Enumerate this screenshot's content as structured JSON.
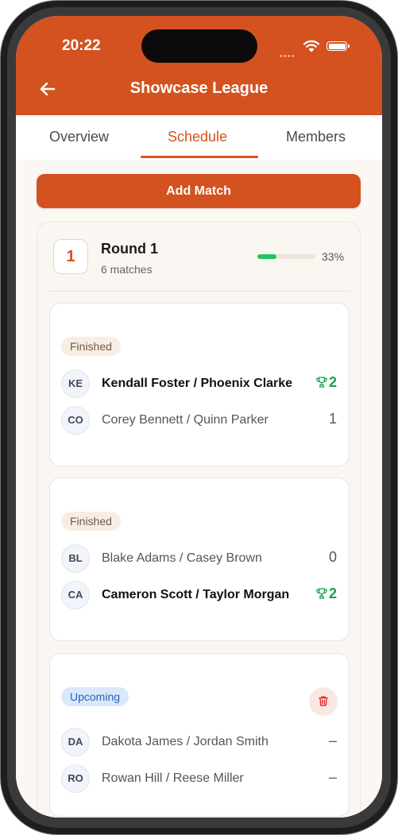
{
  "status_bar": {
    "time": "20:22"
  },
  "header": {
    "title": "Showcase League"
  },
  "tabs": [
    {
      "label": "Overview",
      "active": false
    },
    {
      "label": "Schedule",
      "active": true
    },
    {
      "label": "Members",
      "active": false
    }
  ],
  "actions": {
    "add_match_label": "Add Match"
  },
  "round": {
    "number": "1",
    "title": "Round 1",
    "subtitle": "6 matches",
    "progress_percent": 33,
    "progress_label": "33%"
  },
  "matches": [
    {
      "status": "Finished",
      "teams": [
        {
          "initials": "KE",
          "name": "Kendall Foster / Phoenix Clarke",
          "score": "2",
          "winner": true
        },
        {
          "initials": "CO",
          "name": "Corey Bennett / Quinn Parker",
          "score": "1",
          "winner": false
        }
      ]
    },
    {
      "status": "Finished",
      "teams": [
        {
          "initials": "BL",
          "name": "Blake Adams / Casey Brown",
          "score": "0",
          "winner": false
        },
        {
          "initials": "CA",
          "name": "Cameron Scott / Taylor Morgan",
          "score": "2",
          "winner": true
        }
      ]
    },
    {
      "status": "Upcoming",
      "teams": [
        {
          "initials": "DA",
          "name": "Dakota James / Jordan Smith",
          "score": "–",
          "winner": false
        },
        {
          "initials": "RO",
          "name": "Rowan Hill / Reese Miller",
          "score": "–",
          "winner": false
        }
      ]
    }
  ],
  "icons": {
    "back": "arrow-left-icon",
    "trophy": "trophy-icon",
    "delete": "trash-icon"
  },
  "colors": {
    "brand": "#d4521f",
    "win": "#16a34a",
    "progress": "#22c55e",
    "upcoming": "#2563b5",
    "delete": "#dc2626"
  }
}
